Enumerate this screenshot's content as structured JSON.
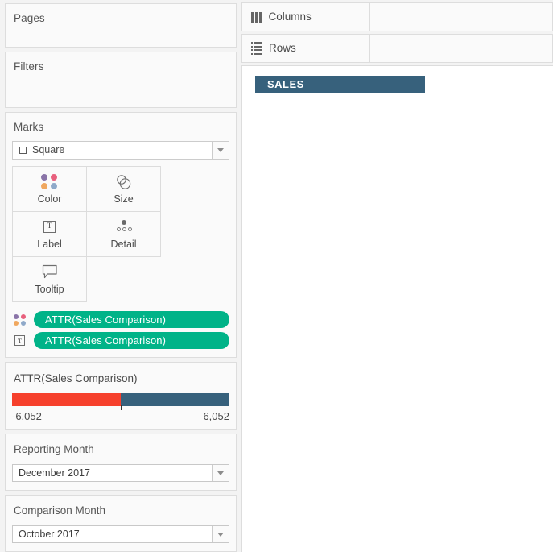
{
  "shelves": {
    "pages": {
      "label": "Pages"
    },
    "filters": {
      "label": "Filters"
    },
    "columns": {
      "label": "Columns",
      "icon": "columns-icon",
      "value": ""
    },
    "rows": {
      "label": "Rows",
      "icon": "rows-icon",
      "value": ""
    }
  },
  "marks": {
    "title": "Marks",
    "mark_type": "Square",
    "mark_type_icon": "square-icon",
    "buttons": [
      {
        "label": "Color",
        "icon": "color-dots-icon"
      },
      {
        "label": "Size",
        "icon": "size-circles-icon"
      },
      {
        "label": "Label",
        "icon": "label-text-icon"
      },
      {
        "label": "Detail",
        "icon": "detail-dots-icon"
      },
      {
        "label": "Tooltip",
        "icon": "tooltip-bubble-icon"
      }
    ],
    "pills": [
      {
        "shelf": "Color",
        "shelf_icon": "color-dots-icon",
        "label": "ATTR(Sales Comparison)"
      },
      {
        "shelf": "Label",
        "shelf_icon": "label-text-icon",
        "label": "ATTR(Sales Comparison)"
      }
    ],
    "pill_color": "#00b388"
  },
  "legend": {
    "title": "ATTR(Sales Comparison)",
    "min_label": "-6,052",
    "max_label": "6,052",
    "negative_color": "#f6402c",
    "positive_color": "#37617c"
  },
  "filters": [
    {
      "title": "Reporting Month",
      "value": "December 2017",
      "icon": "chevron-down-icon"
    },
    {
      "title": "Comparison Month",
      "value": "October 2017",
      "icon": "chevron-down-icon"
    }
  ],
  "canvas": {
    "column_header": "SALES",
    "header_color": "#37617c"
  },
  "palette": {
    "color_dots": [
      "#8a74a8",
      "#e8607d",
      "#f0a860",
      "#8fa9c9"
    ]
  }
}
